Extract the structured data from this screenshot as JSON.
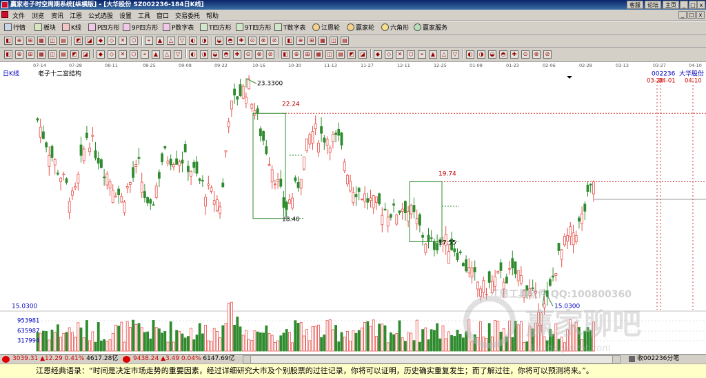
{
  "window": {
    "title": "赢家老子时空周期系统[纵横版] - [大华股份   SZ002236-184日K线]",
    "buttons": [
      "客服",
      "论坛",
      "主页"
    ],
    "controls": [
      "_",
      "□",
      "x"
    ]
  },
  "menu": {
    "items": [
      "文件",
      "浏览",
      "资讯",
      "江恩",
      "公式选股",
      "设置",
      "工具",
      "窗口",
      "交易委托",
      "帮助"
    ]
  },
  "toolbar1": {
    "items": [
      "行情",
      "板块",
      "K线",
      "P四方形",
      "9P四方形",
      "P数字表",
      "T四方形",
      "9T四方形",
      "T数字表",
      "江恩轮",
      "赢家轮",
      "六角形",
      "赢家服务"
    ]
  },
  "chart": {
    "period_label": "日K线",
    "indicator_title": "老子十二宫结构",
    "stock_code": "002236",
    "stock_name": "大华股份",
    "date_axis": [
      "07-14",
      "07-28",
      "08-11",
      "08-25",
      "09-08",
      "09-22",
      "10-16",
      "10-30",
      "11-13",
      "11-27",
      "12-11",
      "12-25",
      "01-08",
      "01-23",
      "02-06",
      "02-28",
      "03-13",
      "03-27",
      "04-10"
    ],
    "marker_dates": [
      "03-26",
      "04-01",
      "04-10"
    ],
    "price_labels": {
      "high": "23.3300",
      "level1": "22.24",
      "low1": "18.40",
      "level2": "19.74",
      "low2": "17.55",
      "low3": "15.0300"
    },
    "volume_axis": {
      "max_price_label": "15.0300",
      "ticks": [
        "953981",
        "635987",
        "317994"
      ]
    },
    "watermark_lines": [
      "江恩工具软件 QQ:100800360",
      "赢家聊吧",
      "jiaoba.yesrot.com"
    ],
    "candle_colors": {
      "up": "#e8504a",
      "down": "#2e8b2e"
    }
  },
  "statusbar": {
    "sh_index": "3039.31",
    "sh_change": "▲12.29",
    "sh_pct": "0.41%",
    "sh_amount": "4617.28亿",
    "sz_index": "9438.24",
    "sz_change": "▲3.49",
    "sz_pct": "0.04%",
    "sz_amount": "6147.69亿",
    "right_label": "收002236分笔"
  },
  "quote": {
    "text": "江恩经典语录：“时间是决定市场走势的重要因素，经过详细研究大市及个别股票的过往记录，你将可以证明，历史确实重复发生；而了解过往，你将可以预测将来。”。"
  }
}
